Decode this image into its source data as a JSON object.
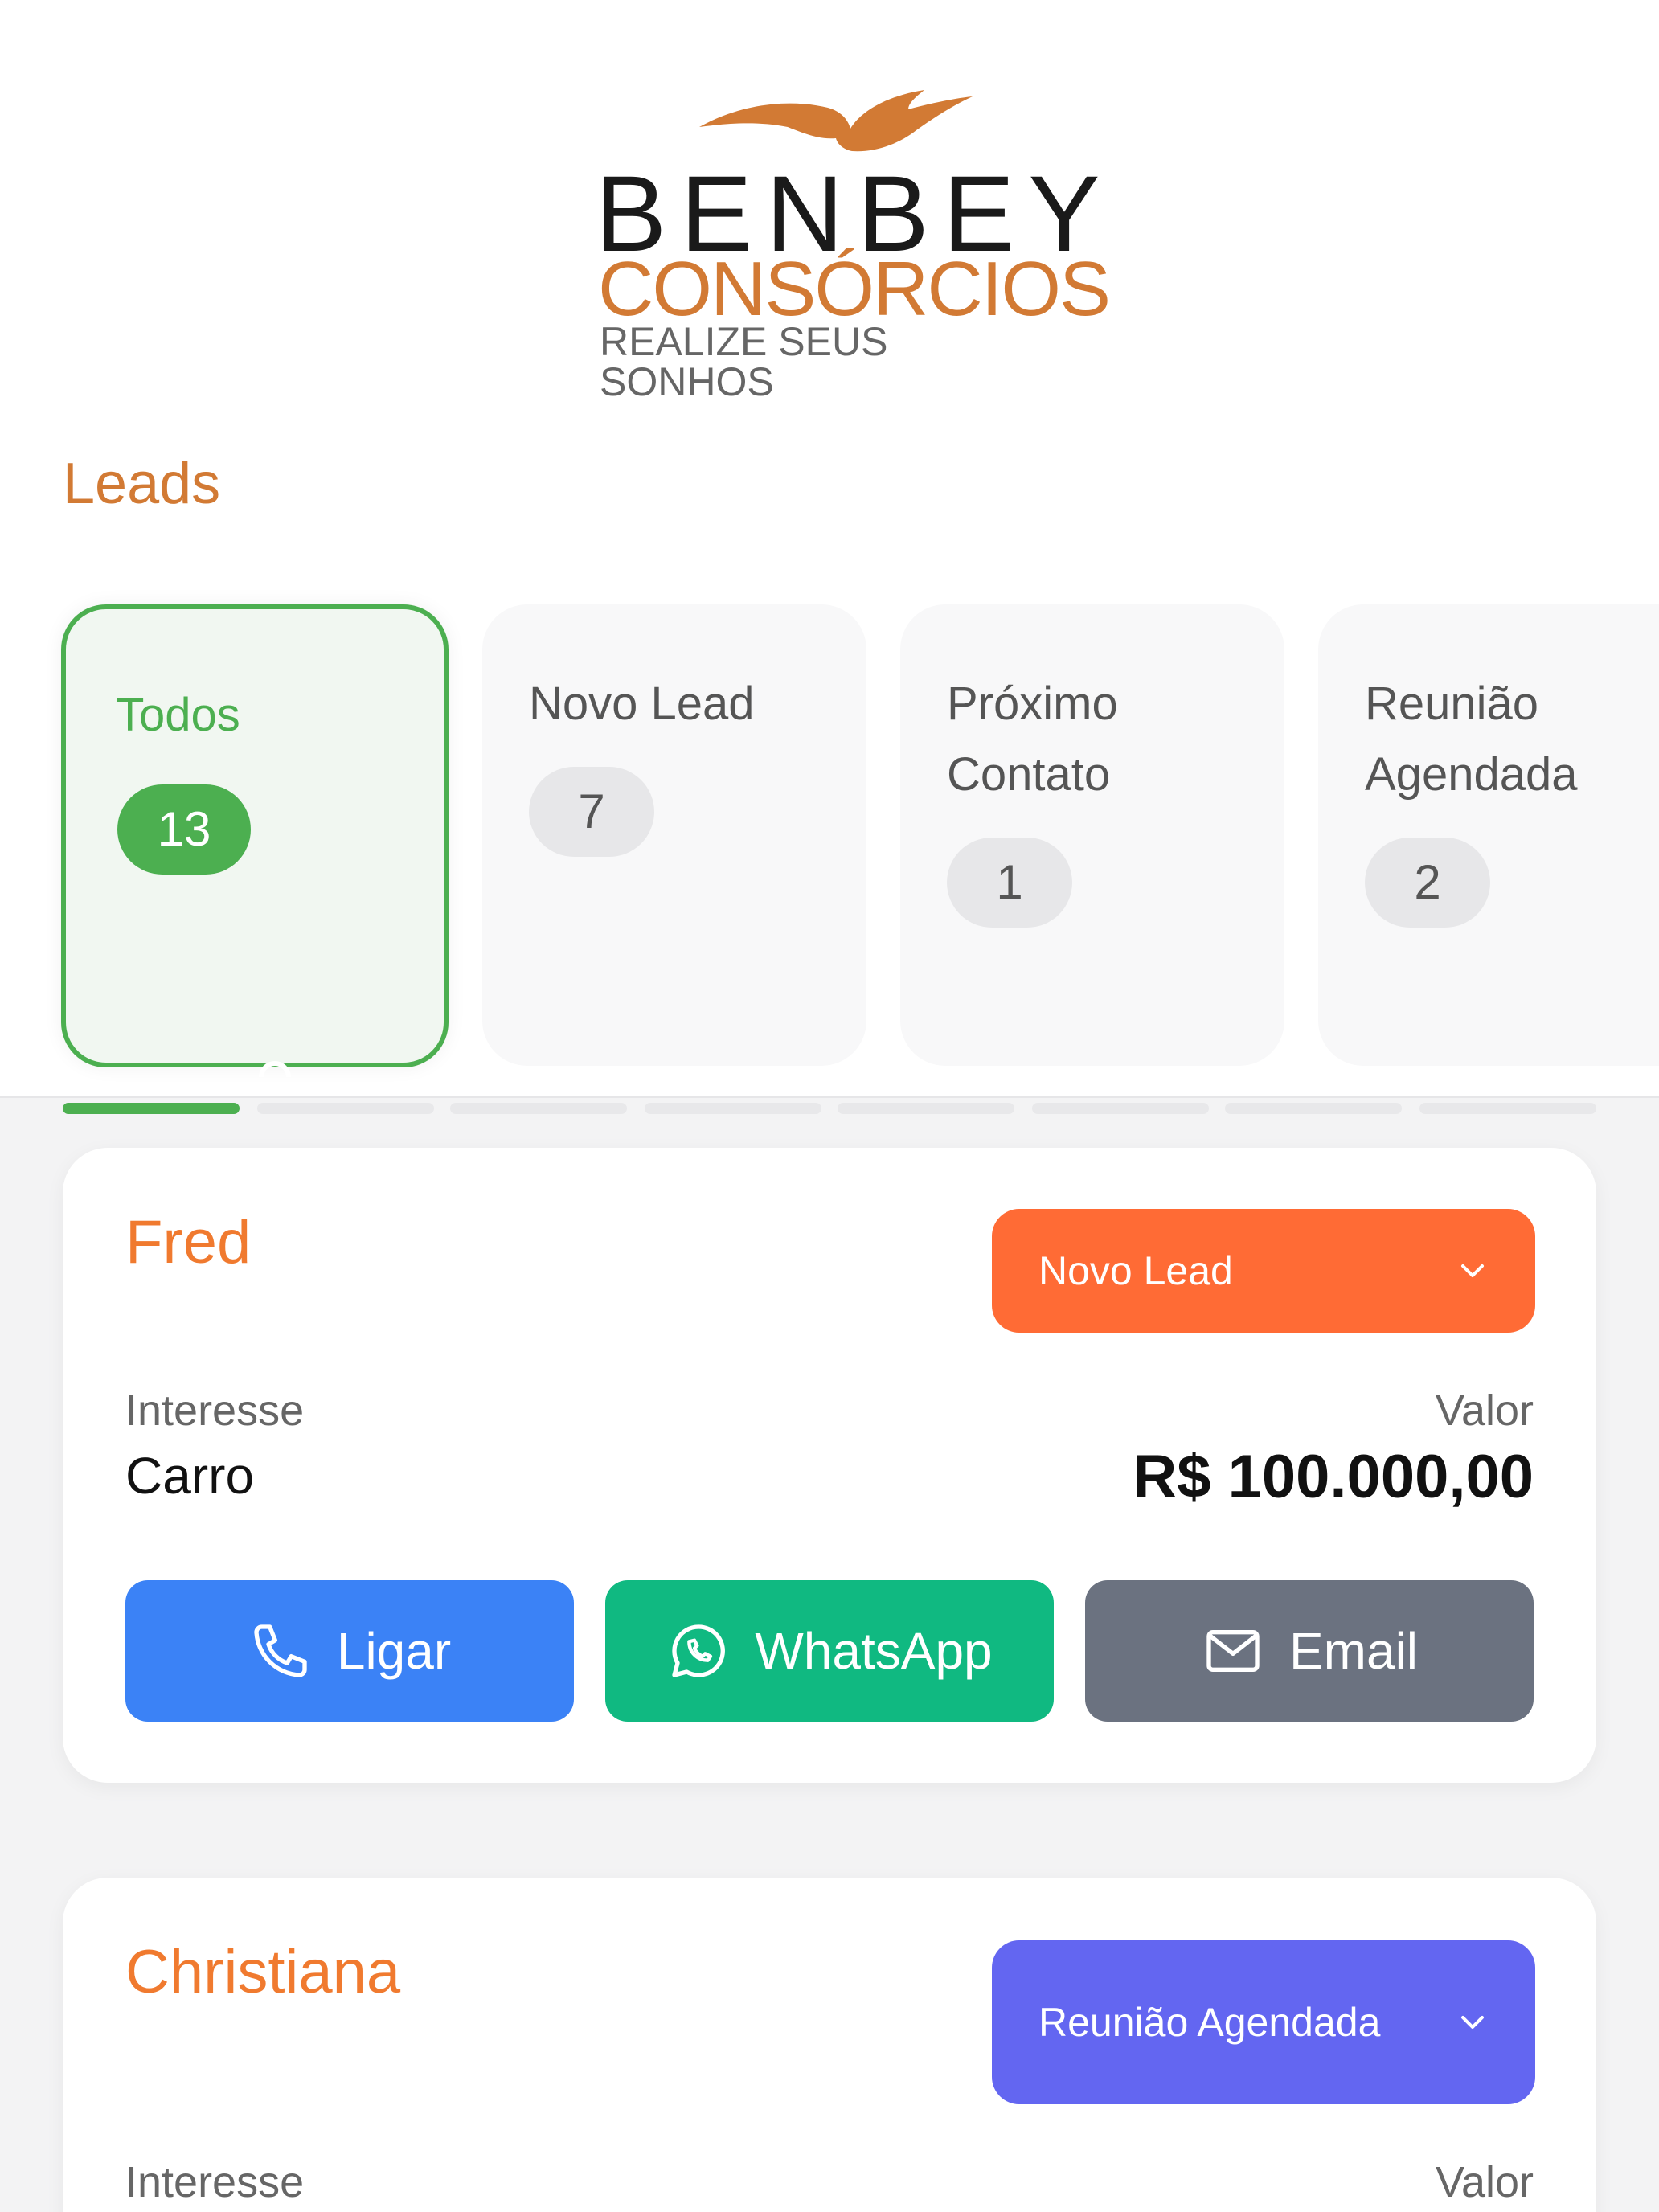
{
  "brand": {
    "name": "BENBEY",
    "sub": "CONSÓRCIOS",
    "tagline": "REALIZE SEUS SONHOS"
  },
  "page": {
    "title": "Leads"
  },
  "filters": [
    {
      "label": "Todos",
      "count": "13",
      "active": true
    },
    {
      "label": "Novo Lead",
      "count": "7",
      "active": false
    },
    {
      "label": "Próximo Contato",
      "count": "1",
      "active": false
    },
    {
      "label": "Reunião Agendada",
      "count": "2",
      "active": false
    }
  ],
  "pager": {
    "segments": 8,
    "active_index": 0
  },
  "leads": [
    {
      "name": "Fred",
      "status": "Novo Lead",
      "status_color": "#ff6b35",
      "interest_label": "Interesse",
      "interest": "Carro",
      "value_label": "Valor",
      "value": "R$ 100.000,00",
      "actions": {
        "call": "Ligar",
        "whatsapp": "WhatsApp",
        "email": "Email"
      }
    },
    {
      "name": "Christiana",
      "status": "Reunião Agendada",
      "status_color": "#6366f1",
      "interest_label": "Interesse",
      "value_label": "Valor"
    }
  ],
  "colors": {
    "accent_orange": "#d27a34",
    "active_green": "#4caf50",
    "call_blue": "#3b82f6",
    "whatsapp_green": "#10b981",
    "email_gray": "#6b7280"
  }
}
